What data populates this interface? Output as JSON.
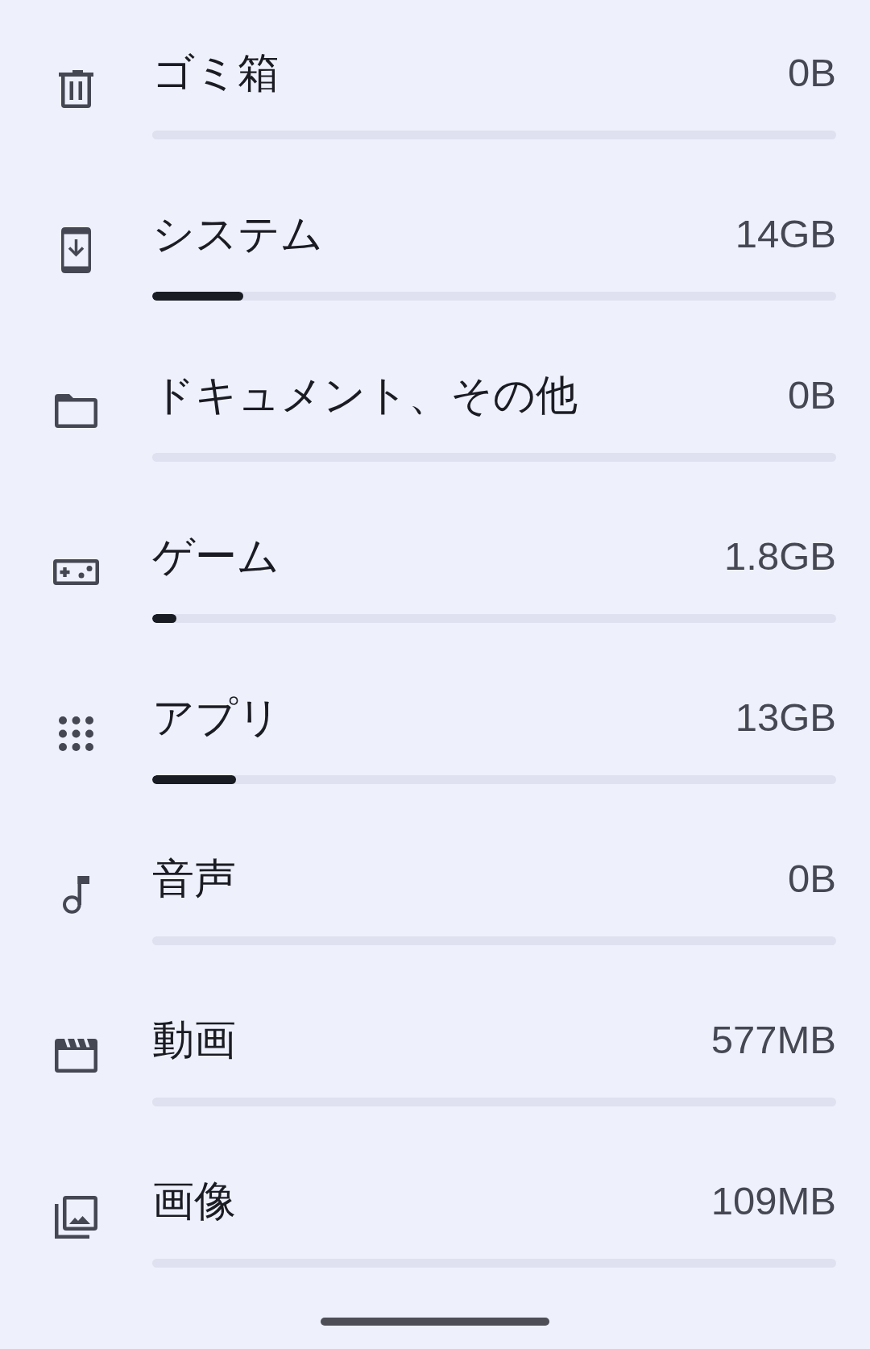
{
  "storage_categories": [
    {
      "label": "ゴミ箱",
      "size": "0B"
    },
    {
      "label": "システム",
      "size": "14GB",
      "level": 0.133
    },
    {
      "label": "ドキュメント、その他",
      "size": "0B"
    },
    {
      "label": "ゲーム",
      "size": "1.8GB",
      "level": 0.035
    },
    {
      "label": "アプリ",
      "size": "13GB",
      "level": 0.123
    },
    {
      "label": "音声",
      "size": "0B"
    },
    {
      "label": "動画",
      "size": "577MB"
    },
    {
      "label": "画像",
      "size": "109MB"
    }
  ]
}
